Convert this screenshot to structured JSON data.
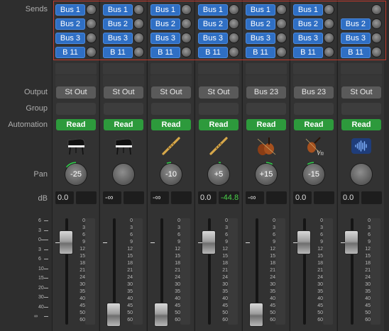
{
  "row_labels": {
    "sends": "Sends",
    "output": "Output",
    "group": "Group",
    "automation": "Automation",
    "pan": "Pan",
    "db": "dB"
  },
  "left_scale": [
    "6",
    "3",
    "0",
    "3",
    "6",
    "10",
    "15",
    "20",
    "30",
    "40",
    "∞"
  ],
  "strip_scale": [
    "0",
    "3",
    "6",
    "9",
    "12",
    "15",
    "18",
    "21",
    "24",
    "30",
    "35",
    "40",
    "45",
    "50",
    "60"
  ],
  "strips": [
    {
      "sends": [
        "Bus 1",
        "Bus 2",
        "Bus 3",
        "B 11"
      ],
      "output": "St Out",
      "automation": "Read",
      "icon": "grand-piano-icon",
      "pan": "-25",
      "pan_value": -25,
      "db_volume": "0.0",
      "db_peak": "",
      "fader_level_db": 0
    },
    {
      "sends": [
        "Bus 1",
        "Bus 2",
        "Bus 3",
        "B 11"
      ],
      "output": "St Out",
      "automation": "Read",
      "icon": "grand-piano-icon",
      "pan": "",
      "pan_value": 0,
      "db_volume": "-∞",
      "db_peak": "",
      "fader_level_db": "-inf"
    },
    {
      "sends": [
        "Bus 1",
        "Bus 2",
        "Bus 3",
        "B 11"
      ],
      "output": "St Out",
      "automation": "Read",
      "icon": "flute-icon",
      "pan": "-10",
      "pan_value": -10,
      "db_volume": "-∞",
      "db_peak": "",
      "fader_level_db": "-inf"
    },
    {
      "sends": [
        "Bus 1",
        "Bus 2",
        "Bus 3",
        "B 11"
      ],
      "output": "St Out",
      "automation": "Read",
      "icon": "flute-icon",
      "pan": "+5",
      "pan_value": 5,
      "db_volume": "0.0",
      "db_peak": "-44.8",
      "fader_level_db": 0
    },
    {
      "sends": [
        "Bus 1",
        "Bus 2",
        "Bus 3",
        "B 11"
      ],
      "output": "Bus 23",
      "automation": "Read",
      "icon": "cello-icon",
      "pan": "+15",
      "pan_value": 15,
      "db_volume": "-∞",
      "db_peak": "",
      "fader_level_db": "-inf"
    },
    {
      "sends": [
        "Bus 1",
        "Bus 2",
        "Bus 3",
        "B 11"
      ],
      "output": "Bus 23",
      "automation": "Read",
      "icon": "violin-icon",
      "pan": "-15",
      "pan_value": -15,
      "db_volume": "0.0",
      "db_peak": "",
      "fader_level_db": 0
    },
    {
      "sends": [
        "",
        "Bus 2",
        "Bus 3",
        "B 11"
      ],
      "output": "St Out",
      "automation": "Read",
      "icon": "waveform-icon",
      "pan": "",
      "pan_value": 0,
      "db_volume": "0.0",
      "db_peak": "",
      "fader_level_db": 0
    }
  ],
  "colors": {
    "send_blue": "#2f6fc4",
    "read_green": "#2d9a3c",
    "highlight_red": "#c0392b",
    "peak_green": "#4bd24b"
  }
}
